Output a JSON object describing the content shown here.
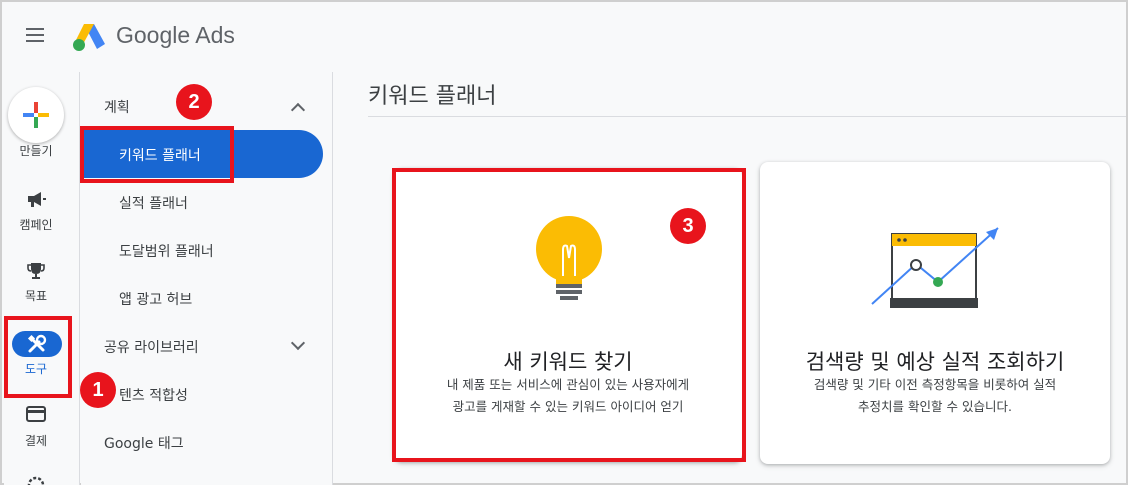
{
  "app": {
    "brand": "Google Ads",
    "colors": {
      "accent": "#1967d2",
      "annotation": "#e8141c"
    }
  },
  "rail": {
    "create_label": "만들기",
    "items": [
      {
        "label": "캠페인",
        "icon": "megaphone-icon"
      },
      {
        "label": "목표",
        "icon": "trophy-icon"
      },
      {
        "label": "도구",
        "icon": "tools-icon",
        "active": true
      },
      {
        "label": "결제",
        "icon": "credit-card-icon"
      }
    ]
  },
  "menu": {
    "section_plan": "계획",
    "active_item": "키워드 플래너",
    "items": [
      "실적 플래너",
      "도달범위 플래너",
      "앱 광고 허브"
    ],
    "section_shared": "공유 라이브러리",
    "content_item": "텐츠 적합성",
    "google_tag": "Google 태그"
  },
  "main": {
    "page_title": "키워드 플래너",
    "cards": [
      {
        "title": "새 키워드 찾기",
        "desc_line1": "내 제품 또는 서비스에 관심이 있는 사용자에게",
        "desc_line2": "광고를 게재할 수 있는 키워드 아이디어 얻기",
        "icon": "lightbulb-icon"
      },
      {
        "title": "검색량 및 예상 실적 조회하기",
        "desc_line1": "검색량 및 기타 이전 측정항목을 비롯하여 실적",
        "desc_line2": "추정치를 확인할 수 있습니다.",
        "icon": "trend-chart-icon"
      }
    ]
  },
  "annotations": {
    "badge1": "1",
    "badge2": "2",
    "badge3": "3"
  }
}
